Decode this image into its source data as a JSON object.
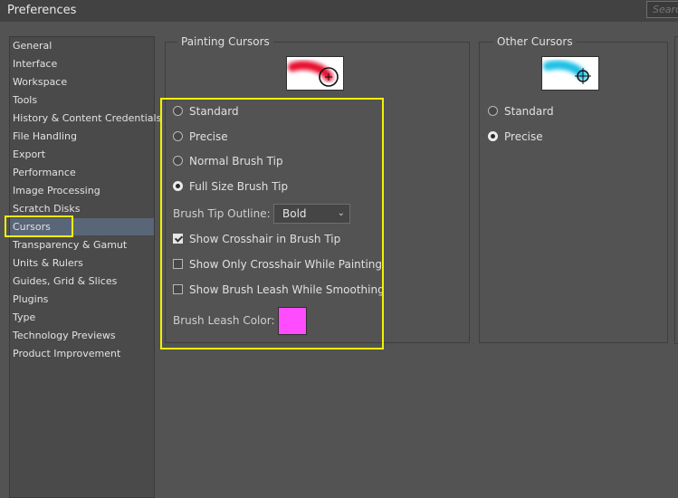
{
  "window": {
    "title": "Preferences",
    "search_placeholder": "Search"
  },
  "sidebar": {
    "items": [
      "General",
      "Interface",
      "Workspace",
      "Tools",
      "History & Content Credentials",
      "File Handling",
      "Export",
      "Performance",
      "Image Processing",
      "Scratch Disks",
      "Cursors",
      "Transparency & Gamut",
      "Units & Rulers",
      "Guides, Grid & Slices",
      "Plugins",
      "Type",
      "Technology Previews",
      "Product Improvement"
    ],
    "active_index": 10
  },
  "painting_cursors": {
    "title": "Painting Cursors",
    "options": [
      "Standard",
      "Precise",
      "Normal Brush Tip",
      "Full Size Brush Tip"
    ],
    "selected": "Full Size Brush Tip",
    "brush_tip_outline_label": "Brush Tip Outline:",
    "brush_tip_outline_value": "Bold",
    "checkboxes": [
      {
        "label": "Show Crosshair in Brush Tip",
        "checked": true
      },
      {
        "label": "Show Only Crosshair While Painting",
        "checked": false
      },
      {
        "label": "Show Brush Leash While Smoothing",
        "checked": false
      }
    ],
    "brush_leash_color_label": "Brush Leash Color:",
    "brush_leash_color": "#ff4cff"
  },
  "other_cursors": {
    "title": "Other Cursors",
    "options": [
      "Standard",
      "Precise"
    ],
    "selected": "Precise"
  },
  "colors": {
    "highlight": "#f2f200",
    "painting_preview_stroke": "#e8102e",
    "other_preview_stroke": "#1ec0e6",
    "sidebar_active": "#596678"
  }
}
